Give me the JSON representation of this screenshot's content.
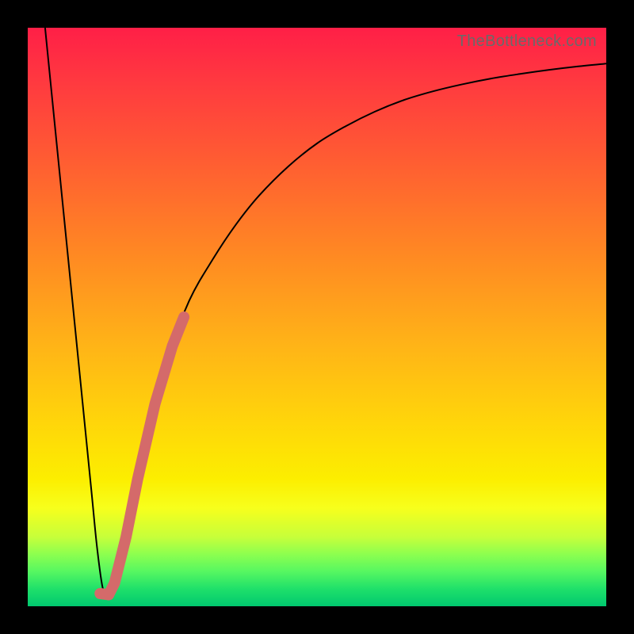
{
  "attribution": "TheBottleneck.com",
  "chart_data": {
    "type": "line",
    "title": "",
    "xlabel": "",
    "ylabel": "",
    "xlim": [
      0,
      100
    ],
    "ylim": [
      0,
      100
    ],
    "series": [
      {
        "name": "bottleneck-curve",
        "x": [
          3,
          5,
          7,
          9,
          11,
          12,
          13,
          14,
          15,
          17,
          19,
          22,
          25,
          28,
          32,
          36,
          40,
          45,
          50,
          55,
          60,
          65,
          70,
          75,
          80,
          85,
          90,
          95,
          100
        ],
        "y": [
          100,
          80,
          60,
          40,
          20,
          10,
          3,
          2,
          4,
          12,
          22,
          35,
          45,
          53,
          60,
          66,
          71,
          76,
          80,
          83,
          85.5,
          87.5,
          89,
          90.2,
          91.2,
          92,
          92.7,
          93.3,
          93.8
        ],
        "color": "#000000",
        "width": 2
      },
      {
        "name": "highlight-segment",
        "x": [
          14,
          15,
          17,
          19,
          22,
          25,
          27
        ],
        "y": [
          2,
          4,
          12,
          22,
          35,
          45,
          50
        ],
        "color": "#d46a6a",
        "width": 14
      },
      {
        "name": "highlight-tip",
        "x": [
          12.5,
          14
        ],
        "y": [
          2.2,
          2
        ],
        "color": "#d46a6a",
        "width": 14
      }
    ]
  }
}
